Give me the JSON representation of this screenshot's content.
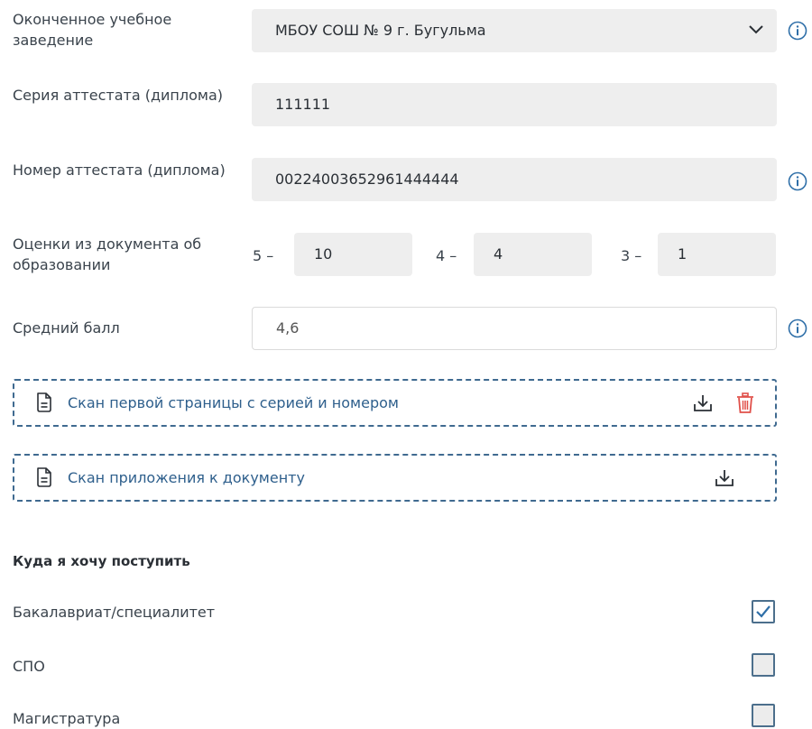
{
  "form": {
    "institution": {
      "label": "Оконченное учебное заведение",
      "value": "МБОУ СОШ № 9 г. Бугульма"
    },
    "series": {
      "label": "Серия аттестата (диплома)",
      "value": "111111"
    },
    "number": {
      "label": "Номер аттестата (диплома)",
      "value": "00224003652961444444"
    },
    "grades": {
      "label": "Оценки из документа об образовании",
      "five_label": "5 –",
      "five_value": "10",
      "four_label": "4 –",
      "four_value": "4",
      "three_label": "3 –",
      "three_value": "1"
    },
    "average": {
      "label": "Средний балл",
      "value": "4,6"
    }
  },
  "uploads": [
    {
      "label": "Скан первой страницы с серией и номером"
    },
    {
      "label": "Скан приложения к документу"
    }
  ],
  "admission": {
    "title": "Куда я хочу поступить",
    "options": [
      {
        "label": "Бакалавриат/специалитет",
        "checked": true
      },
      {
        "label": "СПО",
        "checked": false
      },
      {
        "label": "Магистратура",
        "checked": false
      }
    ]
  },
  "colors": {
    "accent": "#2f6fa8",
    "delete": "#e0504a",
    "border": "#3f6a90"
  }
}
